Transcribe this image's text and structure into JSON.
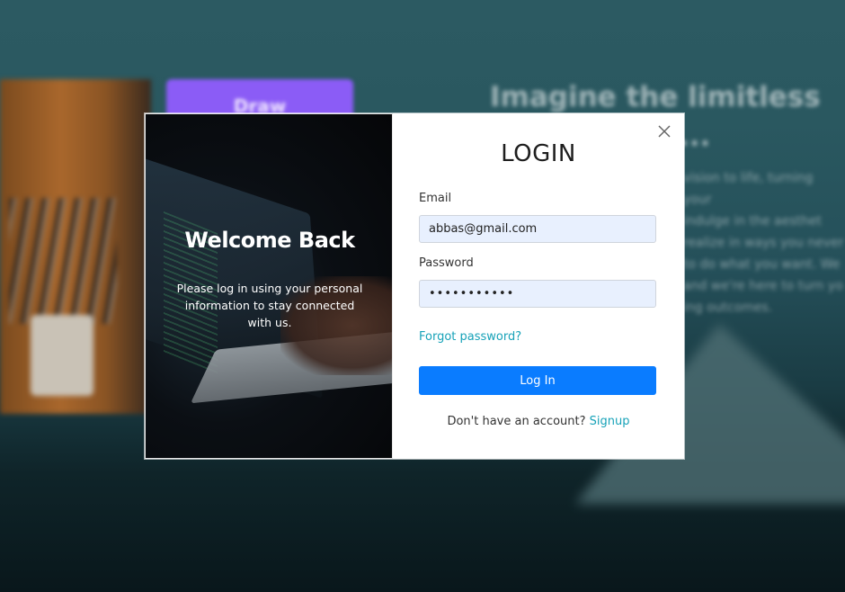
{
  "background": {
    "draw_button_label": "Draw",
    "heading": "Imagine the limitless possibilities...",
    "paragraph": "vision to life, turning your\nindulge in the aesthet\nrealize in ways you never\nto do what you want. We\nand we're here to turn yo\ning outcomes."
  },
  "modal": {
    "left": {
      "title": "Welcome Back",
      "text": "Please log in using your personal information to stay connected with us."
    },
    "right": {
      "title": "LOGIN",
      "email_label": "Email",
      "email_value": "abbas@gmail.com",
      "password_label": "Password",
      "password_value": "•••••••••••",
      "forgot_password": "Forgot password?",
      "login_button": "Log In",
      "signup_prompt": "Don't have an account?",
      "signup_link": "Signup"
    }
  },
  "colors": {
    "primary_button": "#0a7cff",
    "link": "#17a2b8",
    "input_background": "#e8f0fe"
  },
  "icons": {
    "close": "close-icon"
  }
}
